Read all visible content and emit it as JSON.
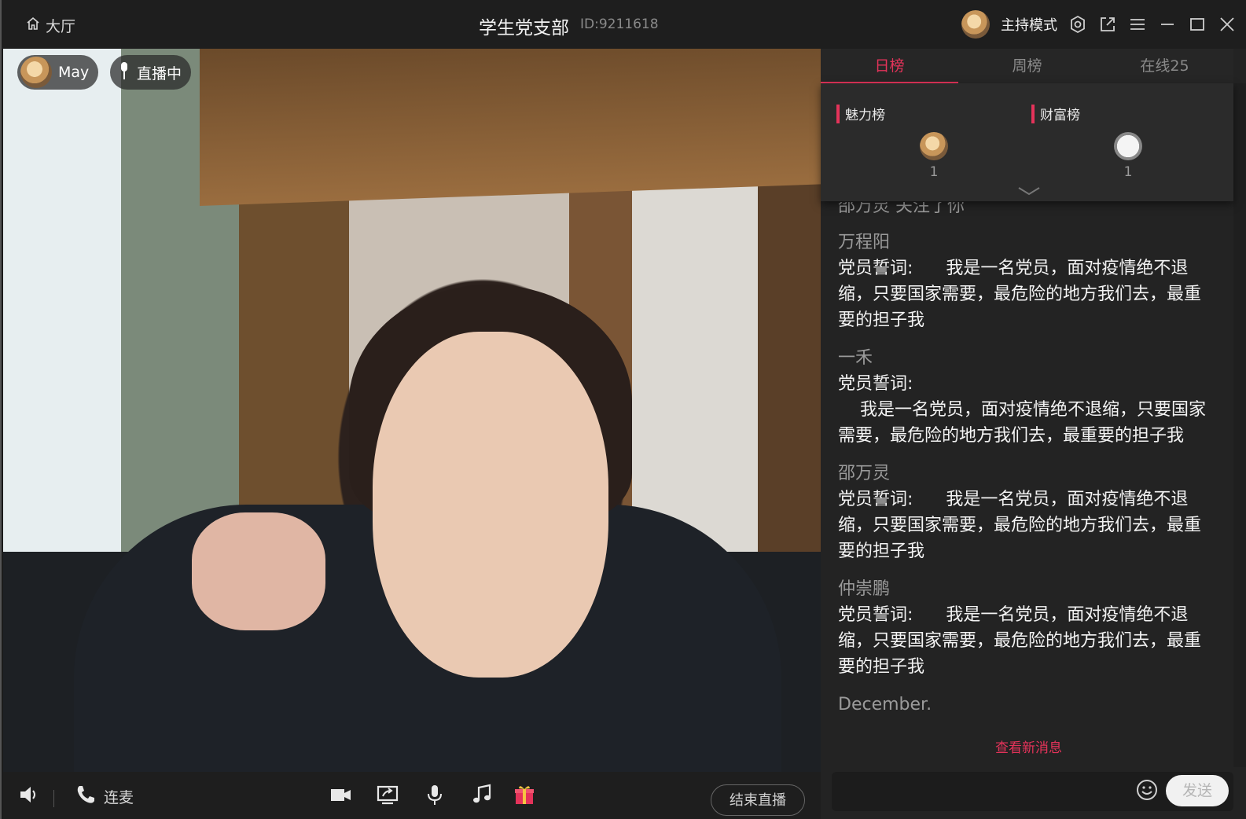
{
  "titlebar": {
    "hall_label": "大厅",
    "room_title": "学生党支部",
    "room_id": "ID:9211618",
    "host_mode_label": "主持模式"
  },
  "video": {
    "host_name": "May",
    "live_status": "直播中"
  },
  "toolbar": {
    "mic_link_label": "连麦",
    "end_live_label": "结束直播"
  },
  "panel": {
    "tabs": [
      {
        "label": "日榜",
        "active": true
      },
      {
        "label": "周榜",
        "active": false
      },
      {
        "label": "在线25",
        "active": false
      }
    ],
    "charm": {
      "title": "魅力榜",
      "count": "1"
    },
    "wealth": {
      "title": "财富榜",
      "count": "1"
    },
    "chat": {
      "partial_top": "邵万灵 关注了你",
      "messages": [
        {
          "sender": "万程阳",
          "text": "党员誓词:      我是一名党员，面对疫情绝不退缩，只要国家需要，最危险的地方我们去，最重要的担子我"
        },
        {
          "sender": "一禾",
          "text": "党员誓词:\n    我是一名党员，面对疫情绝不退缩，只要国家需要，最危险的地方我们去，最重要的担子我"
        },
        {
          "sender": "邵万灵",
          "text": "党员誓词:      我是一名党员，面对疫情绝不退缩，只要国家需要，最危险的地方我们去，最重要的担子我"
        },
        {
          "sender": "仲崇鹏",
          "text": "党员誓词:      我是一名党员，面对疫情绝不退缩，只要国家需要，最危险的地方我们去，最重要的担子我"
        },
        {
          "sender": "December.",
          "text": ""
        }
      ]
    },
    "new_msg_label": "查看新消息",
    "send_label": "发送"
  },
  "colors": {
    "accent": "#e4335a",
    "bg": "#1b1b1b",
    "panel": "#232323"
  }
}
